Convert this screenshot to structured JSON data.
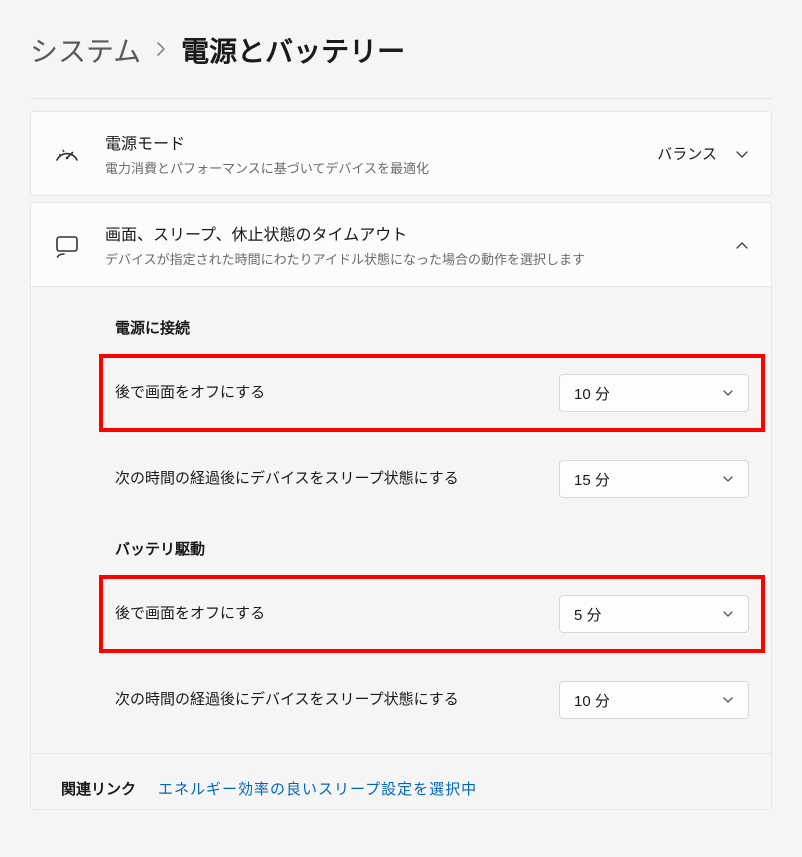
{
  "breadcrumb": {
    "parent": "システム",
    "current": "電源とバッテリー"
  },
  "power_mode": {
    "title": "電源モード",
    "desc": "電力消費とパフォーマンスに基づいてデバイスを最適化",
    "value": "バランス",
    "icon": "gauge-icon"
  },
  "timeouts": {
    "title": "画面、スリープ、休止状態のタイムアウト",
    "desc": "デバイスが指定された時間にわたりアイドル状態になった場合の動作を選択します",
    "icon": "screen-icon",
    "plugged_in": {
      "heading": "電源に接続",
      "screen_off": {
        "label": "後で画面をオフにする",
        "value": "10 分"
      },
      "sleep": {
        "label": "次の時間の経過後にデバイスをスリープ状態にする",
        "value": "15 分"
      }
    },
    "on_battery": {
      "heading": "バッテリ駆動",
      "screen_off": {
        "label": "後で画面をオフにする",
        "value": "5 分"
      },
      "sleep": {
        "label": "次の時間の経過後にデバイスをスリープ状態にする",
        "value": "10 分"
      }
    }
  },
  "related": {
    "label": "関連リンク",
    "link_text": "エネルギー効率の良いスリープ設定を選択中"
  }
}
